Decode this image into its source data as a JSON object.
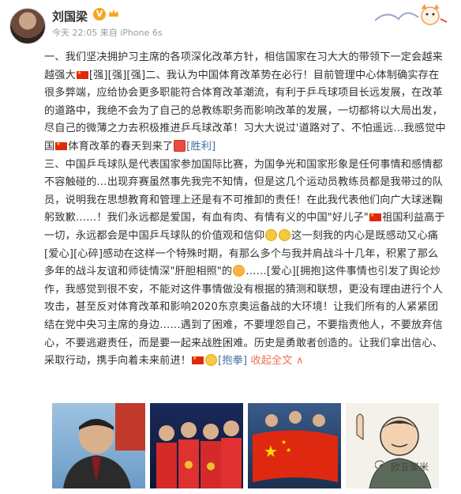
{
  "post": {
    "author": "刘国梁",
    "verified_badge": "V",
    "meta": "今天 22:05 来自 iPhone 6s",
    "para1_a": "一、我们坚决拥护习主席的各项深化改革方针，相信国家在习大大的带领下一定会越来越强大",
    "para1_b": "[强][强][强]二、我认为中国体育改革势在必行！目前管理中心体制确实存在很多弊端，应给协会更多职能符合体育改革潮流，有利于乒乓球项目长远发展，在改革的道路中，我绝不会为了自己的总教练职务而影响改革的发展，一切都将以大局出发，尽自己的微薄之力去积极推进乒乓球改革！习大大说过'道路对了、不怕遥远…我感觉中国",
    "para1_c": "体育改革的春天到来了",
    "para1_d": "[胜利]",
    "para2_a": "三、中国乒乓球队是代表国家参加国际比赛，为国争光和国家形象是任何事情和感情都不容触碰的…出现弃赛虽然事先我完不知情，但是这几个运动员教练员都是我带过的队员，说明我在思想教育和管理上还是有不可推卸的责任！在此我代表他们向广大球迷鞠躬致歉……！我们永远都是爱国，有血有肉、有情有义的中国\"好儿子\"",
    "para2_b": "祖国利益高于一切，永远都会是中国乒乓球队的价值观和信仰",
    "para2_c": "这一刻我的内心是既感动又心痛[爱心][心碎]感动在这样一个特殊时期，有那么多个与我并肩战斗十几年，积累了那么多年的战斗友谊和师徒情深\"肝胆相照\"的",
    "para2_d": "……[爱心][拥抱]这件事情也引发了舆论炒作，我感觉到很不安，不能对这件事情做没有根据的猜测和联想，更没有理由进行个人攻击，甚至反对体育改革和影响2020东京奥运备战的大环境！让我们所有的人紧紧团结在党中央习主席的身边……遇到了困难，不要埋怨自己，不要指责他人，不要放弃信心，不要逃避责任，而是要一起来战胜困难。历史是勇敢者创造的。让我们拿出信心、采取行动，携手向着未来前进！",
    "hug": "[抱拳]",
    "collapse_link": "收起全文",
    "collapse_arrow": "∧"
  },
  "watermark": {
    "text": "欧亚聚米"
  },
  "icons": {
    "avatar": "user-avatar",
    "flag": "china-flag-emoji",
    "strong": "strong-emoji",
    "fist": "fist-emoji",
    "victory": "victory-emoji",
    "people": "people-emoji"
  },
  "colors": {
    "link": "#eb7350",
    "accent": "#f5a623",
    "flag_red": "#de2910"
  }
}
